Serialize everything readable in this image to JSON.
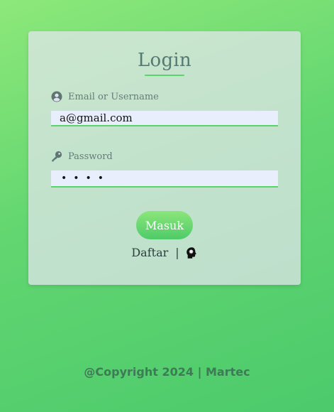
{
  "login": {
    "title": "Login",
    "email_label": "Email or Username",
    "email_value": "a@gmail.com",
    "password_label": "Password",
    "password_mask": "••••",
    "submit_label": "Masuk",
    "register_label": "Daftar",
    "separator": "|"
  },
  "footer": {
    "text": "@Copyright 2024 | Martec"
  },
  "icons": {
    "email": "user-circle-icon",
    "password": "key-icon",
    "extra": "brain-head-icon"
  },
  "colors": {
    "accent": "#5ad36a",
    "title": "#557a73",
    "footer": "#3e7a55"
  }
}
